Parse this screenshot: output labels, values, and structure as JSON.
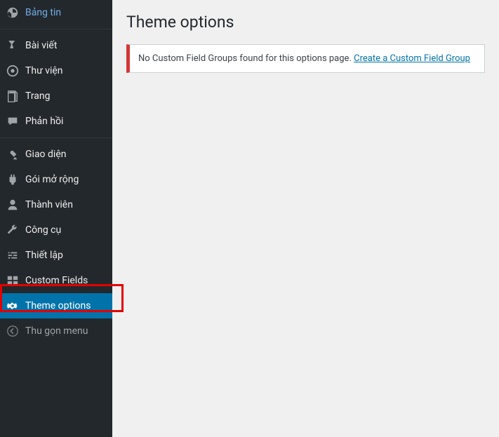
{
  "sidebar": {
    "items": [
      {
        "label": "Bảng tin",
        "icon": "dashboard"
      },
      {
        "label": "Bài viết",
        "icon": "pin"
      },
      {
        "label": "Thư viện",
        "icon": "media"
      },
      {
        "label": "Trang",
        "icon": "pages"
      },
      {
        "label": "Phản hồi",
        "icon": "comments"
      },
      {
        "label": "Giao diện",
        "icon": "appearance"
      },
      {
        "label": "Gói mở rộng",
        "icon": "plugins"
      },
      {
        "label": "Thành viên",
        "icon": "users"
      },
      {
        "label": "Công cụ",
        "icon": "tools"
      },
      {
        "label": "Thiết lập",
        "icon": "settings"
      },
      {
        "label": "Custom Fields",
        "icon": "fields"
      },
      {
        "label": "Theme options",
        "icon": "gear",
        "active": true
      },
      {
        "label": "Thu gọn menu",
        "icon": "collapse",
        "collapse": true
      }
    ]
  },
  "main": {
    "title": "Theme options",
    "notice": {
      "text": "No Custom Field Groups found for this options page. ",
      "link": "Create a Custom Field Group"
    }
  }
}
